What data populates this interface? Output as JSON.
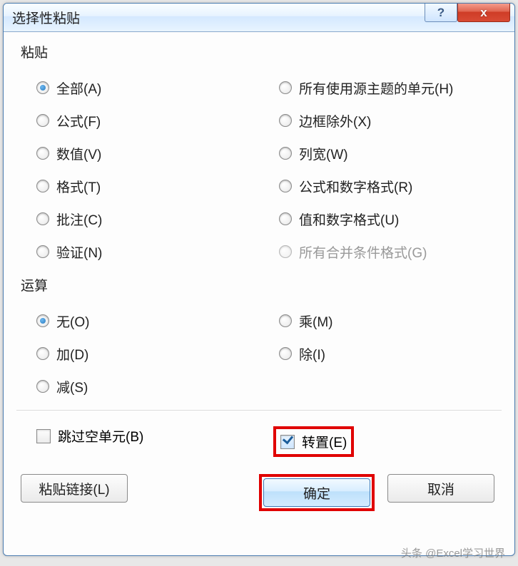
{
  "title": "选择性粘贴",
  "groups": {
    "paste": {
      "title": "粘贴",
      "left": [
        {
          "label": "全部(A)",
          "checked": true
        },
        {
          "label": "公式(F)",
          "checked": false
        },
        {
          "label": "数值(V)",
          "checked": false
        },
        {
          "label": "格式(T)",
          "checked": false
        },
        {
          "label": "批注(C)",
          "checked": false
        },
        {
          "label": "验证(N)",
          "checked": false
        }
      ],
      "right": [
        {
          "label": "所有使用源主题的单元(H)",
          "checked": false
        },
        {
          "label": "边框除外(X)",
          "checked": false
        },
        {
          "label": "列宽(W)",
          "checked": false
        },
        {
          "label": "公式和数字格式(R)",
          "checked": false
        },
        {
          "label": "值和数字格式(U)",
          "checked": false
        },
        {
          "label": "所有合并条件格式(G)",
          "checked": false,
          "disabled": true
        }
      ]
    },
    "operation": {
      "title": "运算",
      "left": [
        {
          "label": "无(O)",
          "checked": true
        },
        {
          "label": "加(D)",
          "checked": false
        },
        {
          "label": "减(S)",
          "checked": false
        }
      ],
      "right": [
        {
          "label": "乘(M)",
          "checked": false
        },
        {
          "label": "除(I)",
          "checked": false
        }
      ]
    }
  },
  "checks": {
    "skip_blanks": {
      "label": "跳过空单元(B)",
      "checked": false
    },
    "transpose": {
      "label": "转置(E)",
      "checked": true
    }
  },
  "buttons": {
    "paste_link": "粘贴链接(L)",
    "ok": "确定",
    "cancel": "取消"
  },
  "watermark": "头条 @Excel学习世界"
}
